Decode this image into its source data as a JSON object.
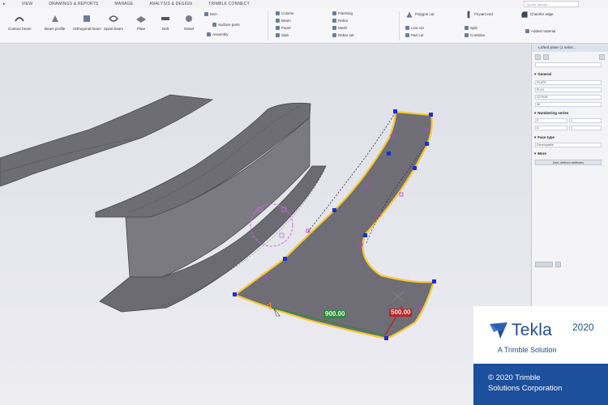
{
  "menu": {
    "tabs": [
      "VIEW",
      "DRAWINGS & REPORTS",
      "MANAGE",
      "ANALYSIS & DESIGN",
      "TRIMBLE CONNECT"
    ],
    "search_placeholder": "Quick launch"
  },
  "ribbon": {
    "buttons": [
      "Contour beam",
      "Beam profile",
      "Orthogonal beam",
      "Spiral beam",
      "Plate",
      "Bolt",
      "Detail",
      "Polygon cut",
      "Fit part end",
      "Chamfer edge"
    ],
    "detail_items": [
      "Item",
      "Surface parts",
      "Assembly"
    ],
    "concrete_items": [
      "Column",
      "Beam",
      "Panel",
      "Slab"
    ],
    "rebar_items": [
      "Finishing",
      "Rebar",
      "Mesh",
      "Rebar set"
    ],
    "cut_items": [
      "Line cut",
      "Part cut"
    ],
    "split_items": [
      "Split",
      "Combine"
    ],
    "chamfer_items": [
      "Added material"
    ]
  },
  "viewport": {
    "dim_left": "900.00",
    "dim_right": "500.00"
  },
  "panel": {
    "title": "Lofted plate (1 selec...",
    "general_label": "General",
    "fields": [
      "PLATE",
      "PL10",
      "S275JR",
      "99"
    ],
    "numbering_label": "Numbering series",
    "num_fields": [
      "P",
      "1",
      "A",
      "1"
    ],
    "face_type_label": "Face type",
    "face_type_value": "Developable",
    "more_label": "More",
    "udf_button": "User-defined attributes"
  },
  "badge": {
    "brand": "Tekla",
    "year": "2020",
    "tagline": "A Trimble Solution",
    "copyright_line1": "© 2020 Trimble",
    "copyright_line2": "Solutions Corporation"
  },
  "colors": {
    "plate_fill": "#6f6e76",
    "highlight": "#f5c932",
    "handle": "#1b2fd6",
    "dim_green": "#2f8a3c",
    "dim_red": "#b3262c",
    "brand_blue": "#1c4f9c"
  }
}
